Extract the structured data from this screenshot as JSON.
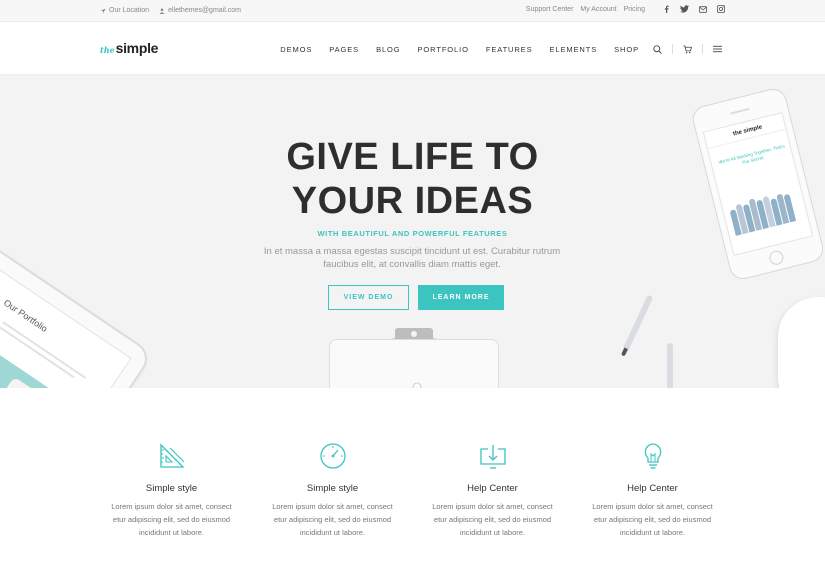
{
  "topbar": {
    "location": "Our Location",
    "email": "ellethemes@gmail.com",
    "links": [
      "Support Center",
      "My Account",
      "Pricing"
    ],
    "social_icons": [
      "facebook-icon",
      "twitter-icon",
      "mail-icon",
      "instagram-icon"
    ]
  },
  "header": {
    "logo_the": "the",
    "logo_name": "simple",
    "menu": [
      "DEMOS",
      "PAGES",
      "BLOG",
      "PORTFOLIO",
      "FEATURES",
      "ELEMENTS",
      "SHOP"
    ],
    "tool_icons": [
      "search-icon",
      "cart-icon",
      "hamburger-menu-icon"
    ]
  },
  "hero": {
    "title_line1": "GIVE LIFE TO",
    "title_line2": "YOUR IDEAS",
    "subtitle": "WITH BEAUTIFUL AND POWERFUL FEATURES",
    "description": "In et massa a massa egestas suscipit tincidunt ut est. Curabitur rutrum faucibus elit, at convallis diam mattis eget.",
    "button_demo": "VIEW DEMO",
    "button_learn": "LEARN MORE",
    "tablet_title": "Our Portfolio",
    "phone_logo": "the simple",
    "phone_headline": "We're All Working Together. That's The Secret."
  },
  "features": [
    {
      "icon": "ruler-triangle-icon",
      "title": "Simple style",
      "text": "Lorem ipsum dolor sit amet, consect etur adipiscing elit, sed do eiusmod incididunt ut labore."
    },
    {
      "icon": "speedometer-icon",
      "title": "Simple style",
      "text": "Lorem ipsum dolor sit amet, consect etur adipiscing elit, sed do eiusmod incididunt ut labore."
    },
    {
      "icon": "download-tray-icon",
      "title": "Help Center",
      "text": "Lorem ipsum dolor sit amet, consect etur adipiscing elit, sed do eiusmod incididunt ut labore."
    },
    {
      "icon": "lightbulb-icon",
      "title": "Help Center",
      "text": "Lorem ipsum dolor sit amet, consect etur adipiscing elit, sed do eiusmod incididunt ut labore."
    }
  ],
  "colors": {
    "accent": "#3cc4c0",
    "heading": "#2e2e2e",
    "hero_bg": "#f3f3f3"
  }
}
